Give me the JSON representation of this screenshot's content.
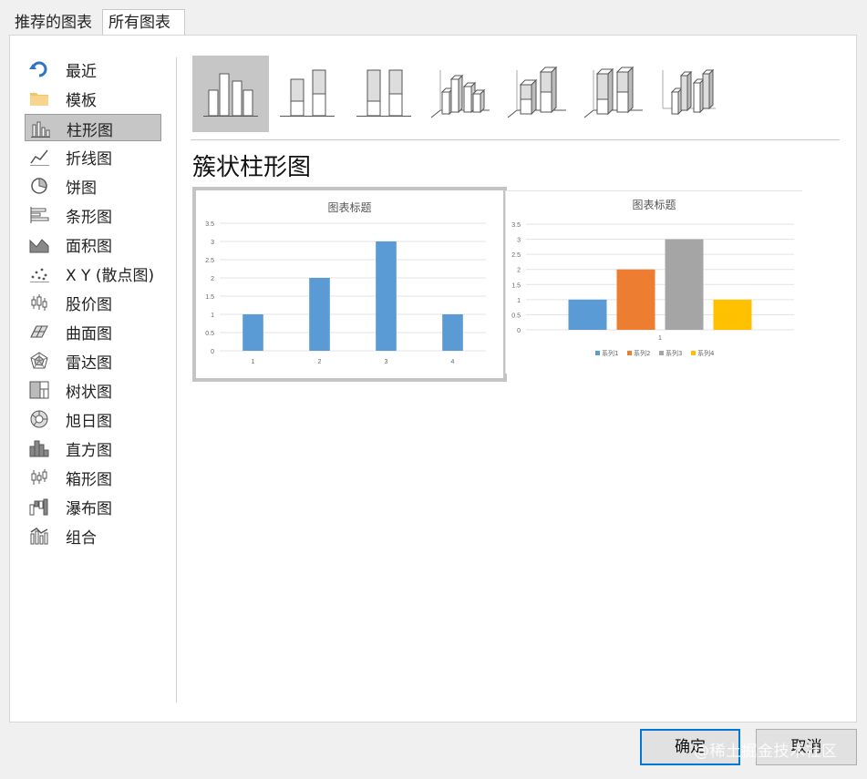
{
  "tabs": [
    {
      "label": "推荐的图表"
    },
    {
      "label": "所有图表"
    }
  ],
  "sidebar": {
    "items": [
      {
        "label": "最近",
        "icon": "recent-arrow-icon"
      },
      {
        "label": "模板",
        "icon": "folder-icon"
      },
      {
        "label": "柱形图",
        "icon": "column-chart-icon",
        "selected": true
      },
      {
        "label": "折线图",
        "icon": "line-chart-icon"
      },
      {
        "label": "饼图",
        "icon": "pie-chart-icon"
      },
      {
        "label": "条形图",
        "icon": "bar-chart-icon"
      },
      {
        "label": "面积图",
        "icon": "area-chart-icon"
      },
      {
        "label": "X Y (散点图)",
        "icon": "scatter-chart-icon"
      },
      {
        "label": "股价图",
        "icon": "stock-chart-icon"
      },
      {
        "label": "曲面图",
        "icon": "surface-chart-icon"
      },
      {
        "label": "雷达图",
        "icon": "radar-chart-icon"
      },
      {
        "label": "树状图",
        "icon": "treemap-chart-icon"
      },
      {
        "label": "旭日图",
        "icon": "sunburst-chart-icon"
      },
      {
        "label": "直方图",
        "icon": "histogram-chart-icon"
      },
      {
        "label": "箱形图",
        "icon": "boxplot-chart-icon"
      },
      {
        "label": "瀑布图",
        "icon": "waterfall-chart-icon"
      },
      {
        "label": "组合",
        "icon": "combo-chart-icon"
      }
    ]
  },
  "subtypes": [
    {
      "icon": "clustered-column-icon",
      "selected": true
    },
    {
      "icon": "stacked-column-icon"
    },
    {
      "icon": "percent-stacked-column-icon"
    },
    {
      "icon": "3d-clustered-column-icon"
    },
    {
      "icon": "3d-stacked-column-icon"
    },
    {
      "icon": "3d-percent-stacked-column-icon"
    },
    {
      "icon": "3d-column-icon"
    }
  ],
  "main": {
    "type_title": "簇状柱形图"
  },
  "colors": {
    "accent": "#0078d7",
    "series1": "#5b9bd5",
    "series2": "#ed7d31",
    "series3": "#a5a5a5",
    "series4": "#ffc000"
  },
  "chart_data": [
    {
      "type": "bar",
      "title": "图表标题",
      "categories": [
        "1",
        "2",
        "3",
        "4"
      ],
      "values": [
        1,
        2,
        3,
        1
      ],
      "ylim": [
        0,
        3.5
      ],
      "yticks": [
        "0",
        "0.5",
        "1",
        "1.5",
        "2",
        "2.5",
        "3",
        "3.5"
      ],
      "grid": true
    },
    {
      "type": "bar",
      "title": "图表标题",
      "categories": [
        "1"
      ],
      "series": [
        {
          "name": "系列1",
          "values": [
            1
          ]
        },
        {
          "name": "系列2",
          "values": [
            2
          ]
        },
        {
          "name": "系列3",
          "values": [
            3
          ]
        },
        {
          "name": "系列4",
          "values": [
            1
          ]
        }
      ],
      "ylim": [
        0,
        3.5
      ],
      "yticks": [
        "0",
        "0.5",
        "1",
        "1.5",
        "2",
        "2.5",
        "3",
        "3.5"
      ],
      "grid": true,
      "legend": "bottom"
    }
  ],
  "buttons": {
    "ok": "确定",
    "cancel": "取消"
  },
  "watermark": "@稀土掘金技术社区"
}
